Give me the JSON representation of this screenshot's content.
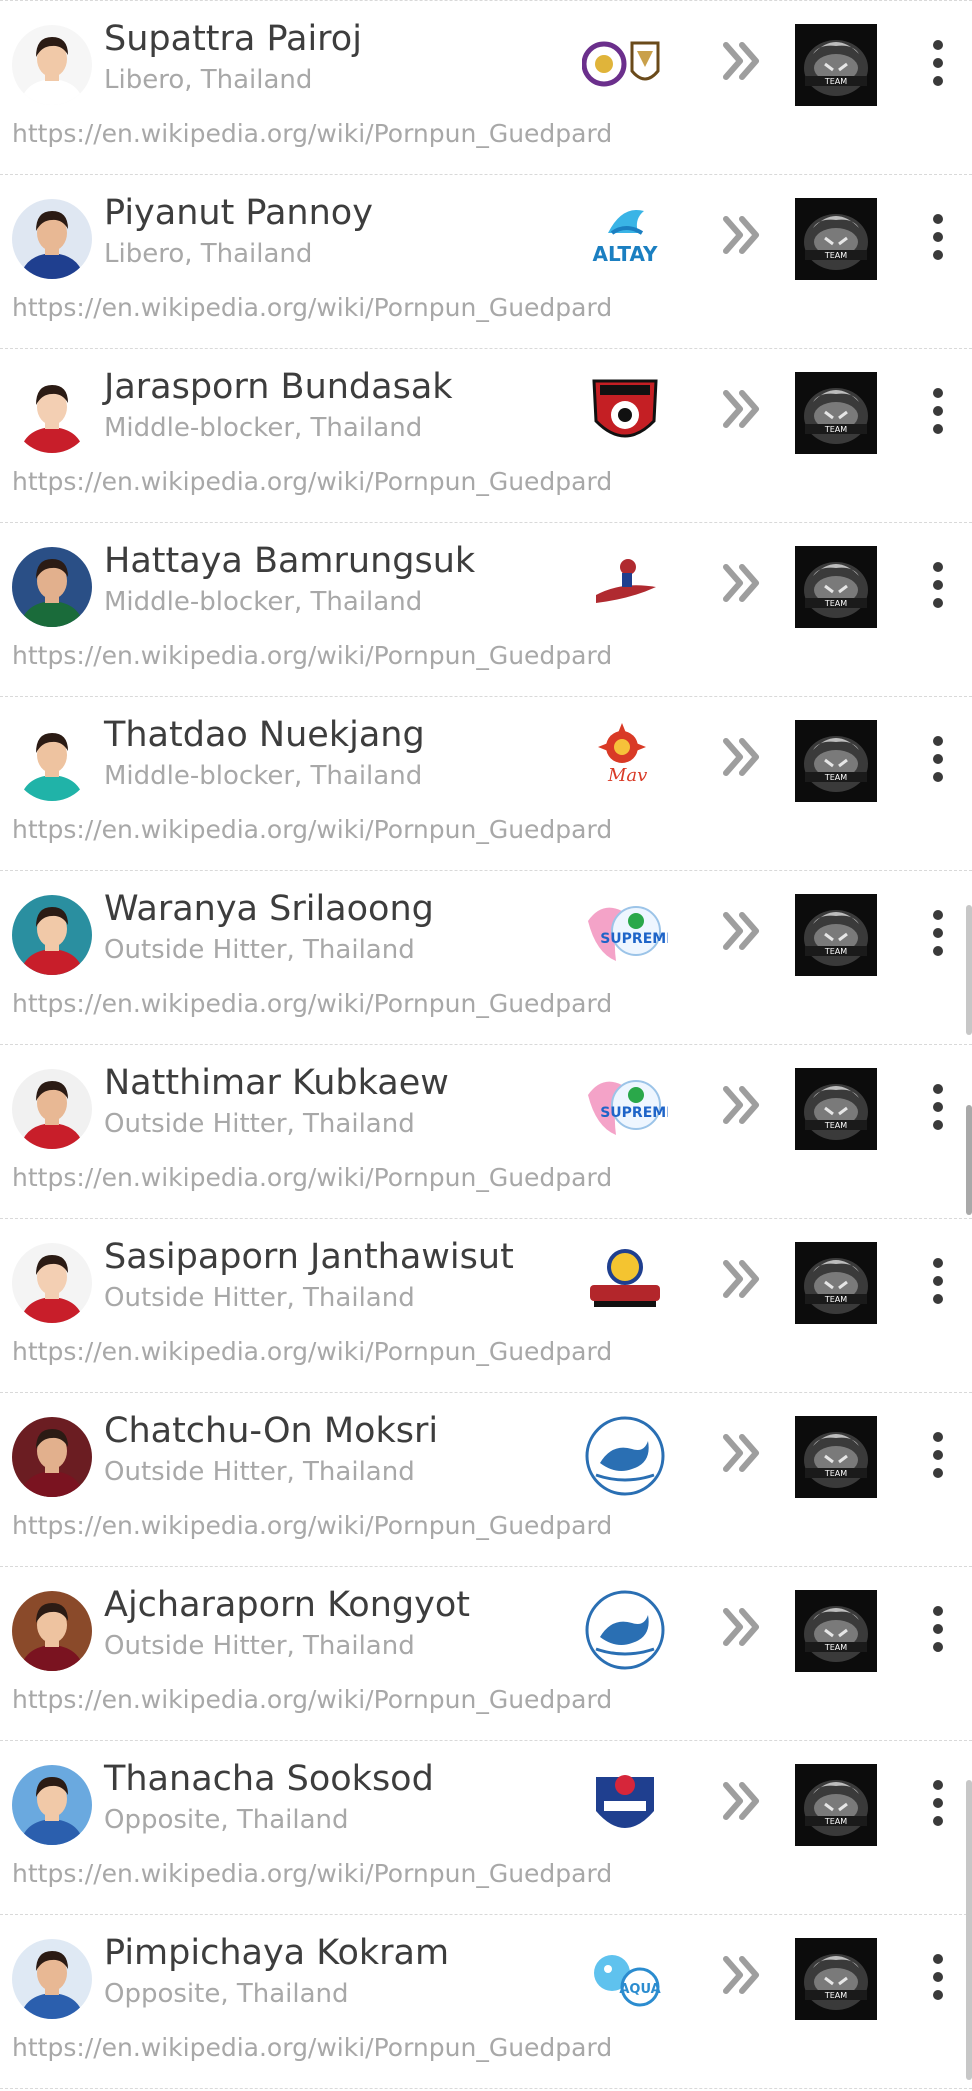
{
  "wiki_link": "https://en.wikipedia.org/wiki/Pornpun_Guedpard",
  "players": [
    {
      "name": "Supattra Pairoj",
      "subtitle": "Libero, Thailand",
      "club_icon": "two-crests-logo",
      "club_color": "#6b2f8c"
    },
    {
      "name": "Piyanut Pannoy",
      "subtitle": "Libero, Thailand",
      "club_icon": "altay-logo",
      "club_color": "#1b7fc1"
    },
    {
      "name": "Jarasporn Bundasak",
      "subtitle": "Middle-blocker, Thailand",
      "club_icon": "red-shield-logo",
      "club_color": "#c41f24"
    },
    {
      "name": "Hattaya Bamrungsuk",
      "subtitle": "Middle-blocker, Thailand",
      "club_icon": "olympians-logo",
      "club_color": "#b02a30"
    },
    {
      "name": "Thatdao Nuekjang",
      "subtitle": "Middle-blocker, Thailand",
      "club_icon": "mavericks-logo",
      "club_color": "#d93a26"
    },
    {
      "name": "Waranya Srilaoong",
      "subtitle": "Outside Hitter, Thailand",
      "club_icon": "supreme-logo",
      "club_color": "#1e64c8"
    },
    {
      "name": "Natthimar Kubkaew",
      "subtitle": "Outside Hitter, Thailand",
      "club_icon": "supreme-logo",
      "club_color": "#1e64c8"
    },
    {
      "name": "Sasipaporn Janthawisut",
      "subtitle": "Outside Hitter, Thailand",
      "club_icon": "beximco-logo",
      "club_color": "#b3262b"
    },
    {
      "name": "Chatchu-On Moksri",
      "subtitle": "Outside Hitter, Thailand",
      "club_icon": "karsiyaka-logo",
      "club_color": "#2a6fb3"
    },
    {
      "name": "Ajcharaporn Kongyot",
      "subtitle": "Outside Hitter, Thailand",
      "club_icon": "karsiyaka-logo",
      "club_color": "#2a6fb3"
    },
    {
      "name": "Thanacha Sooksod",
      "subtitle": "Opposite, Thailand",
      "club_icon": "hipass-logo",
      "club_color": "#1f3f8f"
    },
    {
      "name": "Pimpichaya Kokram",
      "subtitle": "Opposite, Thailand",
      "club_icon": "aqua-logo",
      "club_color": "#2b8ccf"
    }
  ]
}
